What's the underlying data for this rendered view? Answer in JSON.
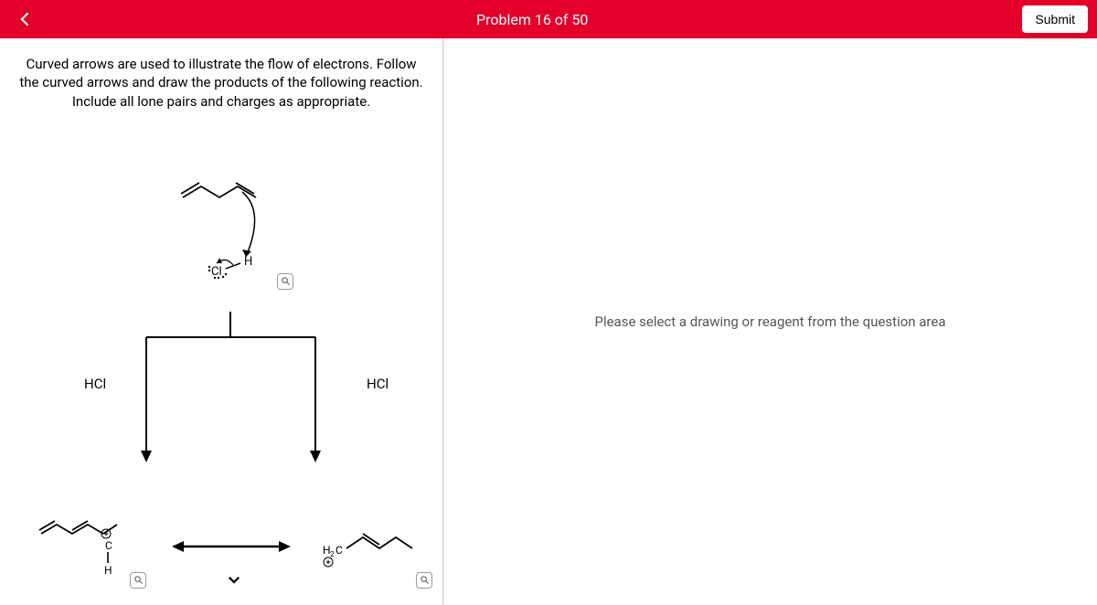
{
  "header": {
    "title": "Problem 16 of 50",
    "submit_label": "Submit"
  },
  "instructions": "Curved arrows are used to illustrate the flow of electrons. Follow the curved arrows and draw the products of the following reaction. Include all lone pairs and charges as appropriate.",
  "labels": {
    "hcl_left": "HCl",
    "hcl_right": "HCl",
    "cl_atom": "Cl",
    "h_atom": "H",
    "c_atom": "C",
    "h_c": "H",
    "h2c": "H₂C",
    "plus": "⊕"
  },
  "right_panel": {
    "placeholder": "Please select a drawing or reagent from the question area"
  }
}
